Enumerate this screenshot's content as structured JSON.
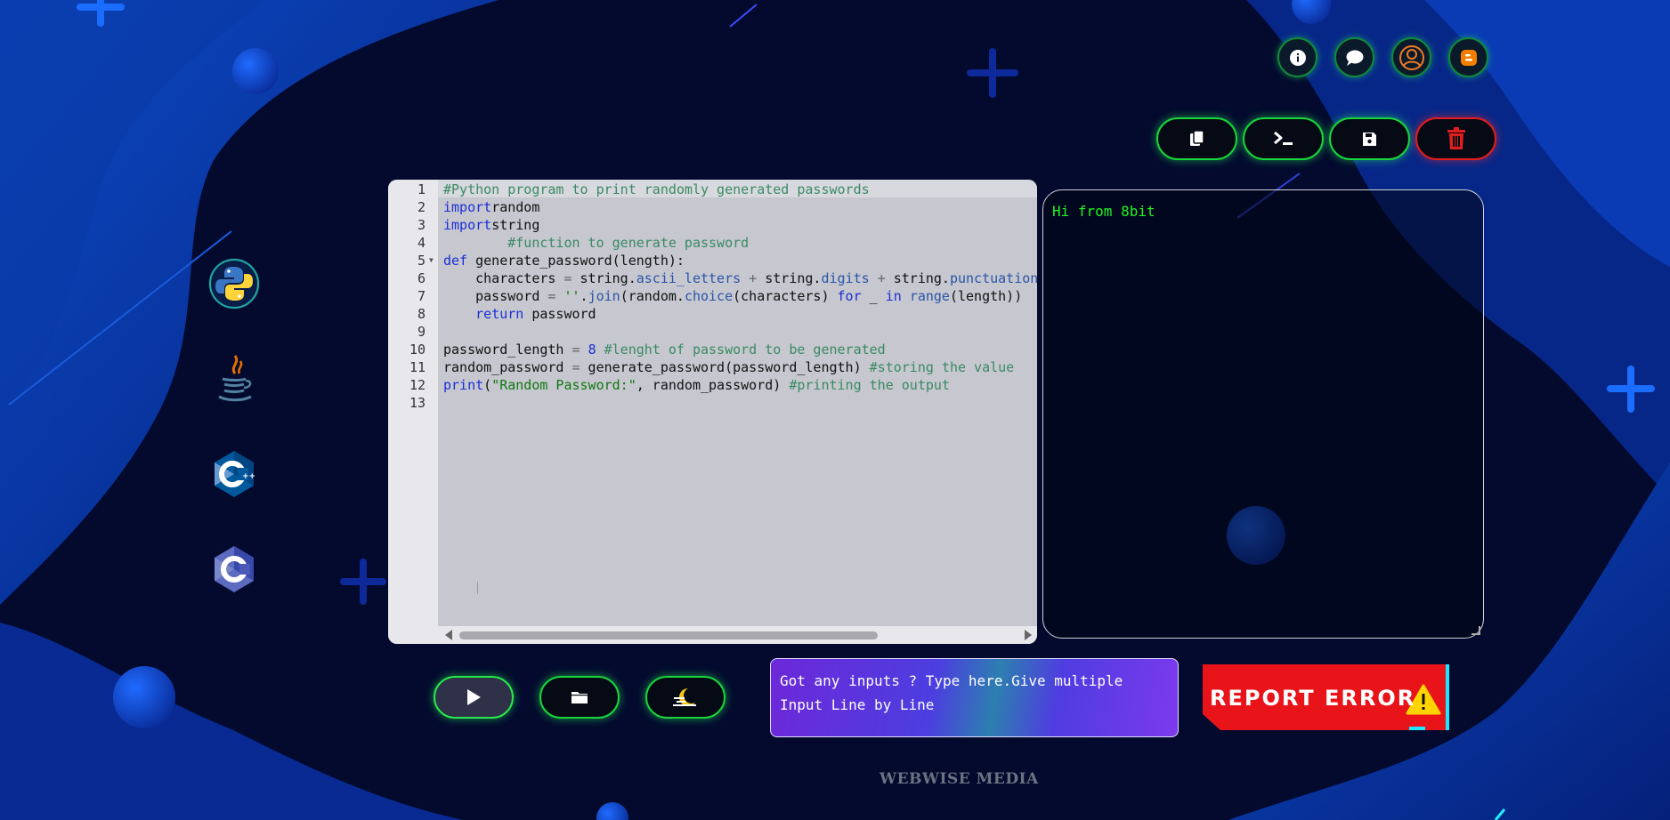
{
  "top_icons": [
    {
      "name": "info-icon"
    },
    {
      "name": "chat-icon"
    },
    {
      "name": "user-profile-icon"
    },
    {
      "name": "blogger-icon"
    }
  ],
  "toolbar": [
    {
      "name": "copy-icon"
    },
    {
      "name": "terminal-icon"
    },
    {
      "name": "save-icon"
    },
    {
      "name": "trash-icon"
    }
  ],
  "languages": [
    {
      "name": "python",
      "selected": true
    },
    {
      "name": "java",
      "selected": false
    },
    {
      "name": "cpp",
      "selected": false
    },
    {
      "name": "c",
      "selected": false
    }
  ],
  "editor": {
    "line_numbers": [
      "1",
      "2",
      "3",
      "4",
      "5",
      "6",
      "7",
      "8",
      "9",
      "10",
      "11",
      "12",
      "13"
    ],
    "lines": [
      [
        [
          "cm",
          "#Python program to print randomly generated passwords"
        ]
      ],
      [
        [
          "kw",
          "import"
        ],
        [
          "",
          "random"
        ]
      ],
      [
        [
          "kw",
          "import"
        ],
        [
          "",
          "string"
        ]
      ],
      [
        [
          "",
          "        "
        ],
        [
          "cm",
          "#function to generate password"
        ]
      ],
      [
        [
          "kw",
          "def"
        ],
        [
          "",
          " generate_password(length):"
        ]
      ],
      [
        [
          "",
          "    characters "
        ],
        [
          "op",
          "="
        ],
        [
          "",
          " string."
        ],
        [
          "fn",
          "ascii_letters"
        ],
        [
          "",
          " "
        ],
        [
          "op",
          "+"
        ],
        [
          "",
          " string."
        ],
        [
          "fn",
          "digits"
        ],
        [
          "",
          " "
        ],
        [
          "op",
          "+"
        ],
        [
          "",
          " string."
        ],
        [
          "fn",
          "punctuation"
        ]
      ],
      [
        [
          "",
          "    password "
        ],
        [
          "op",
          "="
        ],
        [
          "",
          " "
        ],
        [
          "st",
          "''"
        ],
        [
          "",
          "."
        ],
        [
          "fn",
          "join"
        ],
        [
          "",
          "(random."
        ],
        [
          "fn",
          "choice"
        ],
        [
          "",
          "(characters) "
        ],
        [
          "kw",
          "for"
        ],
        [
          "",
          " _ "
        ],
        [
          "kw",
          "in"
        ],
        [
          "",
          " "
        ],
        [
          "fn",
          "range"
        ],
        [
          "",
          "(length))"
        ]
      ],
      [
        [
          "",
          "    "
        ],
        [
          "kw",
          "return"
        ],
        [
          "",
          " password"
        ]
      ],
      [
        [
          "",
          ""
        ]
      ],
      [
        [
          "",
          "password_length "
        ],
        [
          "op",
          "="
        ],
        [
          "",
          " "
        ],
        [
          "nm",
          "8"
        ],
        [
          "",
          " "
        ],
        [
          "cm",
          "#lenght of password to be generated"
        ]
      ],
      [
        [
          "",
          "random_password "
        ],
        [
          "op",
          "="
        ],
        [
          "",
          " generate_password(password_length) "
        ],
        [
          "cm",
          "#storing the value"
        ]
      ],
      [
        [
          "kw",
          "print"
        ],
        [
          "",
          "("
        ],
        [
          "st",
          "\"Random Password:\""
        ],
        [
          "",
          ", random_password) "
        ],
        [
          "cm",
          "#printing the output"
        ]
      ],
      [
        [
          "",
          ""
        ]
      ]
    ]
  },
  "output": {
    "text": "Hi from 8bit"
  },
  "input": {
    "placeholder": "Got any inputs ? Type here.Give multiple Input Line by Line"
  },
  "bottom_buttons": [
    {
      "name": "run-icon"
    },
    {
      "name": "folder-icon"
    },
    {
      "name": "theme-toggle-icon"
    }
  ],
  "report": {
    "label": "REPORT ERROR"
  },
  "footer": {
    "text": "WEBWISE MEDIA"
  },
  "colors": {
    "accent_green": "#18d63a",
    "danger_red": "#e11d1d",
    "output_text": "#1ef51e",
    "report_bg": "#e8141a"
  }
}
